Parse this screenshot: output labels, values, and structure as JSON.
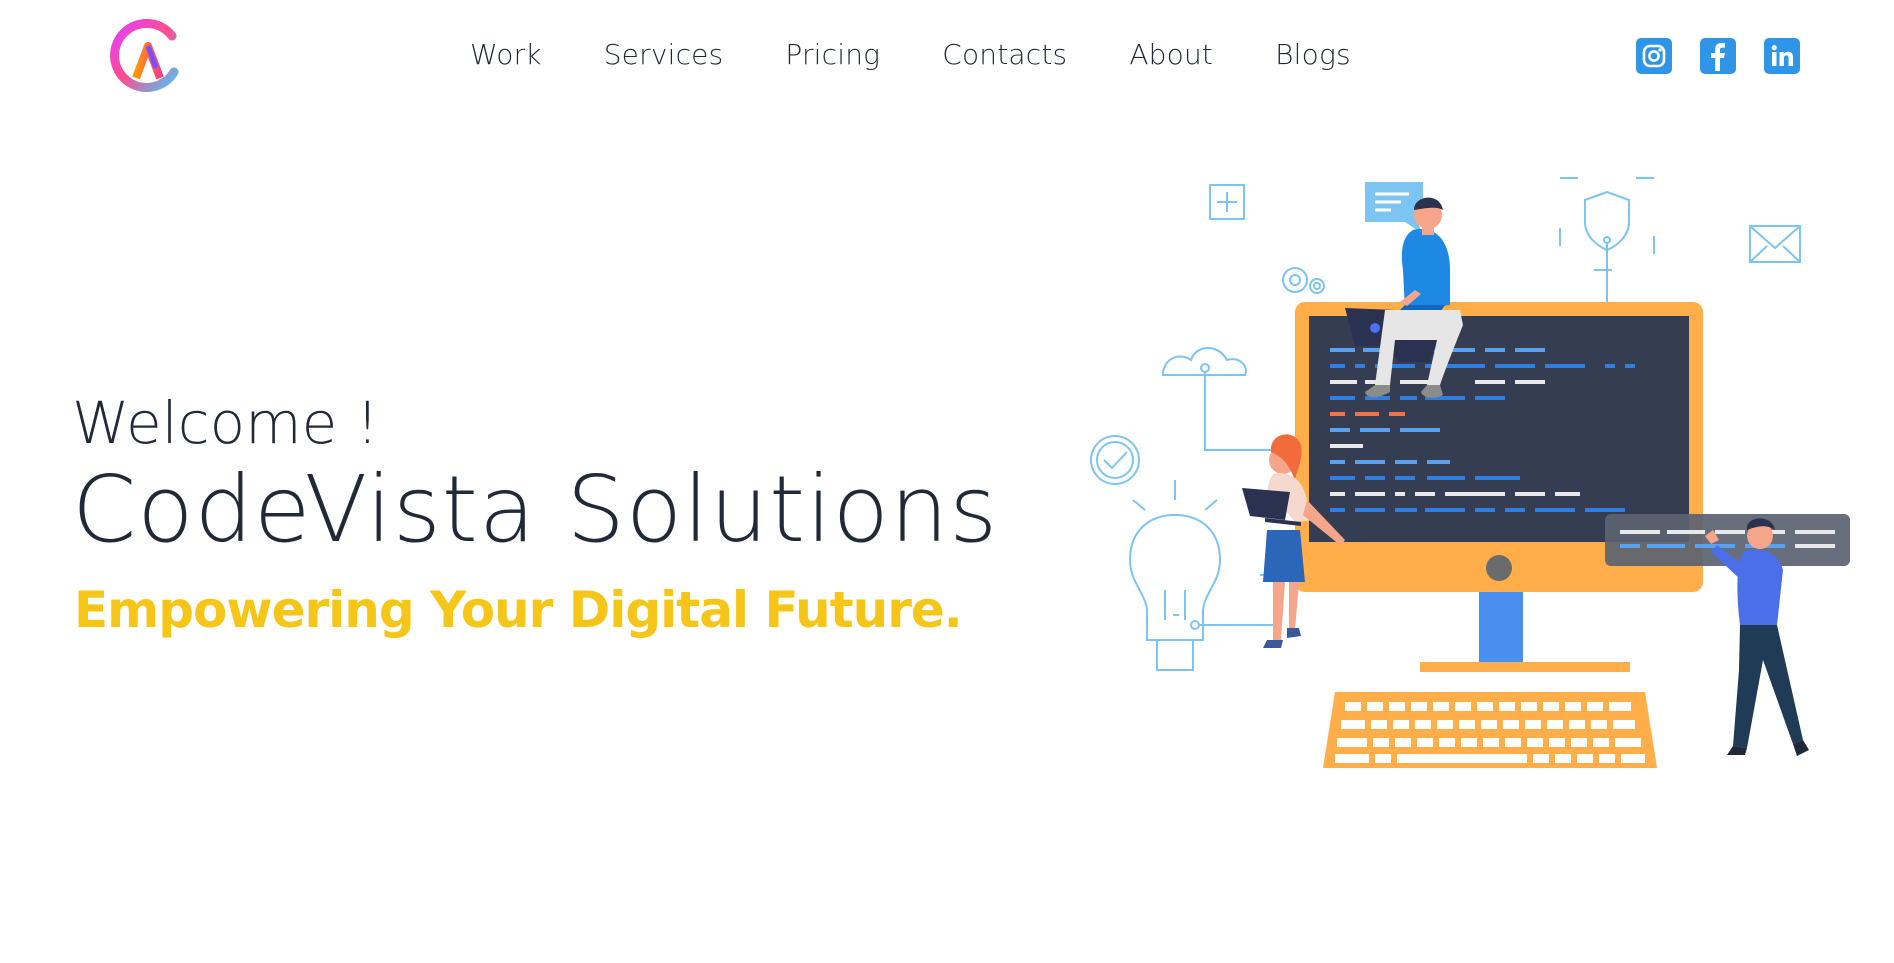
{
  "header": {
    "logo_icon": "ca-monogram-logo-icon",
    "nav": [
      {
        "label": "Work"
      },
      {
        "label": "Services"
      },
      {
        "label": "Pricing"
      },
      {
        "label": "Contacts"
      },
      {
        "label": "About"
      },
      {
        "label": "Blogs"
      }
    ],
    "social": [
      {
        "icon": "instagram-icon",
        "color": "#2f95e6"
      },
      {
        "icon": "facebook-icon",
        "color": "#2f95e6"
      },
      {
        "icon": "linkedin-icon",
        "color": "#2f95e6"
      }
    ]
  },
  "hero": {
    "welcome": "Welcome !",
    "title": "CodeVista Solutions",
    "tagline": "Empowering Your Digital Future."
  },
  "colors": {
    "text": "#1f2937",
    "tagline": "#f5c518",
    "accent": "#2f95e6"
  },
  "illustration": {
    "icon": "developers-at-computer-illustration"
  }
}
